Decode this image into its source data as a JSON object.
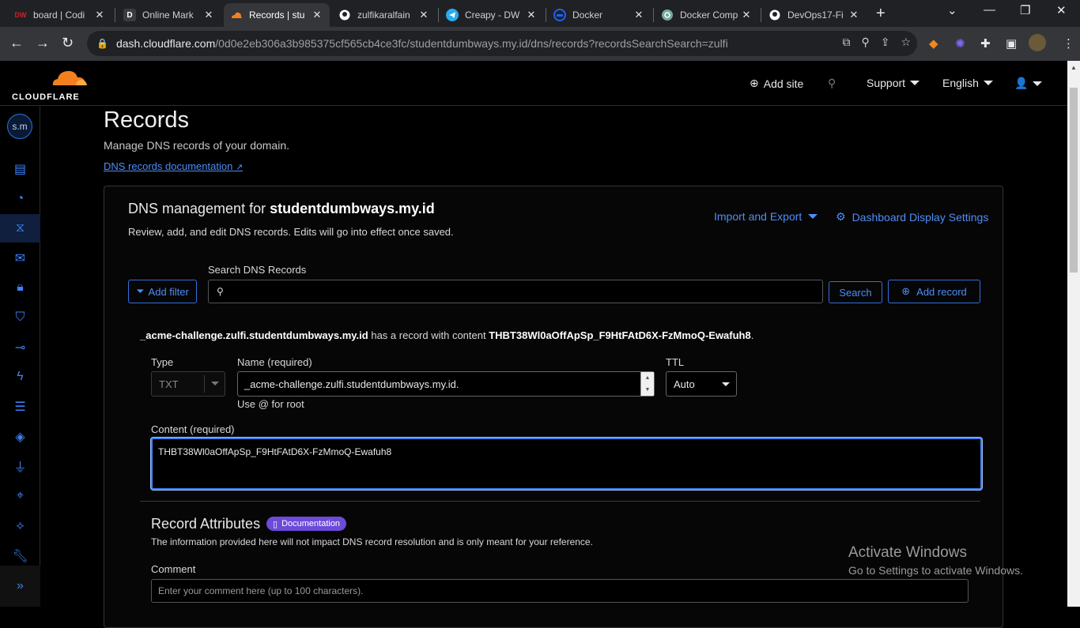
{
  "browser": {
    "tabs": [
      {
        "title": "board | Codi",
        "favicon": "DW",
        "favicon_color": "#d61f26",
        "active": false
      },
      {
        "title": "Online Mark",
        "favicon": "D",
        "favicon_color": "#3c3c3c",
        "active": false
      },
      {
        "title": "Records | stu",
        "favicon": "cloudflare-icon",
        "favicon_color": "#f38020",
        "active": true
      },
      {
        "title": "zulfikaralfain",
        "favicon": "github-icon",
        "favicon_color": "#ffffff",
        "active": false
      },
      {
        "title": "Creapy - DW",
        "favicon": "telegram-icon",
        "favicon_color": "#2aabee",
        "active": false
      },
      {
        "title": "Docker",
        "favicon": "docker-icon",
        "favicon_color": "#1d63ed",
        "active": false
      },
      {
        "title": "Docker Comp",
        "favicon": "chatgpt-icon",
        "favicon_color": "#74aa9c",
        "active": false
      },
      {
        "title": "DevOps17-Fi",
        "favicon": "github-icon",
        "favicon_color": "#ffffff",
        "active": false
      }
    ],
    "url_host": "dash.cloudflare.com",
    "url_path": "/0d0e2eb306a3b985375cf565cb4ce3fc/studentdumbways.my.id/dns/records?recordsSearchSearch=zulfi"
  },
  "header": {
    "logo_text": "CLOUDFLARE",
    "add_site": "Add site",
    "support": "Support",
    "language": "English"
  },
  "sidebar": {
    "account_initials": "s.m",
    "items": [
      "overview-icon",
      "analytics-icon",
      "dns-icon",
      "email-icon",
      "ssl-icon",
      "security-icon",
      "access-icon",
      "speed-icon",
      "caching-icon",
      "workers-icon",
      "rules-icon",
      "network-icon",
      "traffic-icon",
      "tools-icon"
    ],
    "active_index": 2
  },
  "page": {
    "title": "Records",
    "subtitle": "Manage DNS records of your domain.",
    "doc_link": "DNS records documentation"
  },
  "dns": {
    "title_prefix": "DNS management for",
    "domain": "studentdumbways.my.id",
    "description": "Review, add, and edit DNS records. Edits will go into effect once saved.",
    "import_export": "Import and Export",
    "display_settings": "Dashboard Display Settings",
    "search_label": "Search DNS Records",
    "search_value": "",
    "add_filter": "Add filter",
    "search_button": "Search",
    "add_record": "Add record"
  },
  "record": {
    "summary_name": "_acme-challenge.zulfi.studentdumbways.my.id",
    "summary_middle": "has a record with content",
    "summary_content": "THBT38Wl0aOffApSp_F9HtFAtD6X-FzMmoQ-Ewafuh8",
    "summary_end": ".",
    "type_label": "Type",
    "type_value": "TXT",
    "name_label": "Name (required)",
    "name_value": "_acme-challenge.zulfi.studentdumbways.my.id.",
    "name_hint": "Use @ for root",
    "ttl_label": "TTL",
    "ttl_value": "Auto",
    "content_label": "Content (required)",
    "content_value": "THBT38Wl0aOffApSp_F9HtFAtD6X-FzMmoQ-Ewafuh8"
  },
  "attributes": {
    "title": "Record Attributes",
    "badge": "Documentation",
    "description": "The information provided here will not impact DNS record resolution and is only meant for your reference.",
    "comment_label": "Comment",
    "comment_placeholder": "Enter your comment here (up to 100 characters)."
  },
  "watermark": {
    "line1": "Activate Windows",
    "line2": "Go to Settings to activate Windows."
  },
  "colors": {
    "accent": "#3b82f6",
    "link": "#4f8df7",
    "brand_orange": "#f38020",
    "badge_purple": "#6b4bd8"
  }
}
